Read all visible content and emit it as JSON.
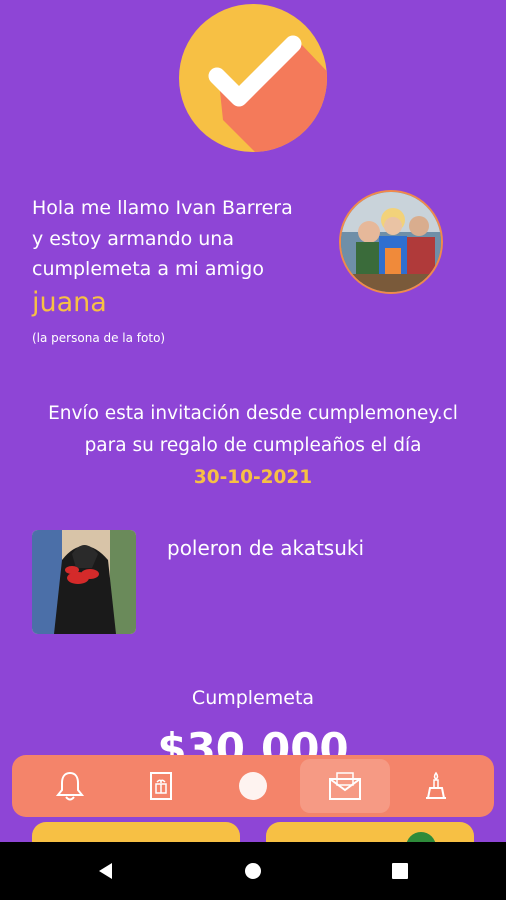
{
  "intro": {
    "lines": [
      "Hola me llamo Ivan Barrera",
      "y estoy armando una",
      "cumplemeta a mi amigo"
    ],
    "friend_name": "juana",
    "friend_note": "(la persona de la foto)"
  },
  "invitation": {
    "line1": "Envío esta invitación desde cumplemoney.cl",
    "line2": "para su regalo de cumpleaños el día",
    "date": "30-10-2021"
  },
  "gift": {
    "name": "poleron de akatsuki"
  },
  "goal": {
    "label": "Cumplemeta",
    "amount": "$30.000"
  },
  "nav": {
    "items": [
      {
        "icon": "bell-icon",
        "active": false
      },
      {
        "icon": "gift-card-icon",
        "active": false
      },
      {
        "icon": "circle-icon",
        "active": false
      },
      {
        "icon": "envelope-icon",
        "active": true
      },
      {
        "icon": "cake-icon",
        "active": false
      }
    ]
  },
  "colors": {
    "background": "#8e45d6",
    "accent_yellow": "#f7c044",
    "nav_bar": "#f4846a"
  }
}
